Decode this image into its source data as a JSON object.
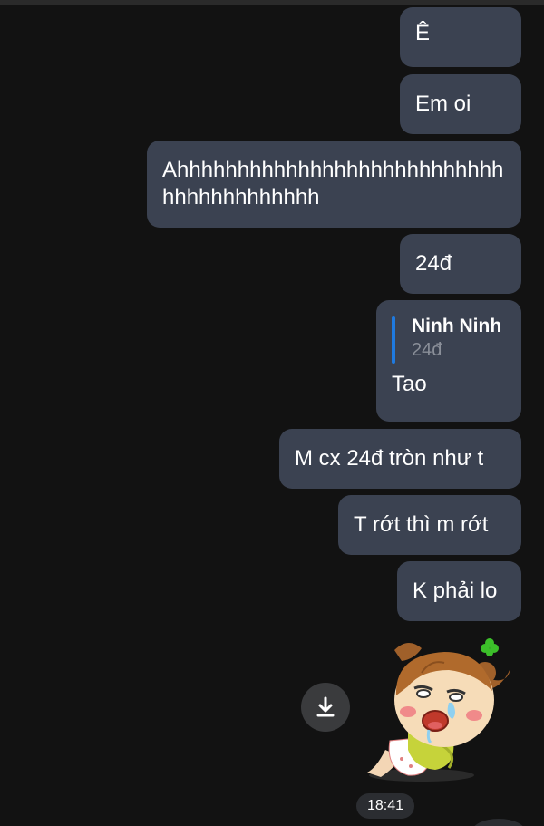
{
  "messages": [
    {
      "text": "Ê"
    },
    {
      "text": "Em oi"
    },
    {
      "text": "Ahhhhhhhhhhhhhhhhhhhhhhhhhhhhhhhhhhhhhhhh"
    },
    {
      "text": "24đ"
    },
    {
      "reply_to": {
        "sender": "Ninh Ninh",
        "snippet": "24đ"
      },
      "text": "Tao"
    },
    {
      "text": "M cx 24đ tròn như t"
    },
    {
      "text": "T rớt thì m rớt"
    },
    {
      "text": "K phải lo"
    }
  ],
  "sticker": {
    "icon": "crying-girl-sticker"
  },
  "download": {
    "icon": "download-icon"
  },
  "timestamp": "18:41",
  "colors": {
    "background": "#121212",
    "bubble": "#3b4251",
    "reply_accent": "#1f7ae0"
  }
}
